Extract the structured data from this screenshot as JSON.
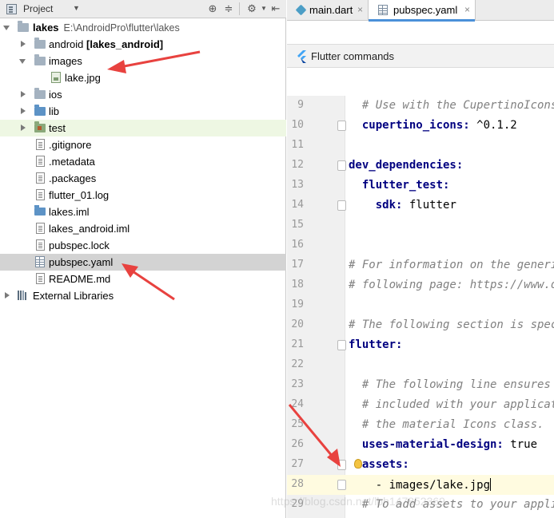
{
  "project_pane": {
    "title": "Project",
    "tree": [
      {
        "label": "lakes",
        "path": "E:\\AndroidPro\\flutter\\lakes",
        "icon": "folder-icon",
        "expanded": true
      },
      {
        "label": "android",
        "suffix": "[lakes_android]",
        "icon": "folder-icon",
        "expanded": false
      },
      {
        "label": "images",
        "icon": "folder-icon",
        "expanded": true
      },
      {
        "label": "lake.jpg",
        "icon": "image-file-icon"
      },
      {
        "label": "ios",
        "icon": "folder-icon",
        "expanded": false
      },
      {
        "label": "lib",
        "icon": "folder-icon",
        "expanded": false
      },
      {
        "label": "test",
        "icon": "test-folder-icon",
        "expanded": false
      },
      {
        "label": ".gitignore",
        "icon": "text-file-icon"
      },
      {
        "label": ".metadata",
        "icon": "text-file-icon"
      },
      {
        "label": ".packages",
        "icon": "text-file-icon"
      },
      {
        "label": "flutter_01.log",
        "icon": "text-file-icon"
      },
      {
        "label": "lakes.iml",
        "icon": "module-file-icon"
      },
      {
        "label": "lakes_android.iml",
        "icon": "text-file-icon"
      },
      {
        "label": "pubspec.lock",
        "icon": "text-file-icon"
      },
      {
        "label": "pubspec.yaml",
        "icon": "yaml-file-icon",
        "selected": true
      },
      {
        "label": "README.md",
        "icon": "text-file-icon"
      },
      {
        "label": "External Libraries",
        "icon": "library-icon",
        "expanded": false
      }
    ]
  },
  "editor": {
    "tabs": [
      {
        "label": "main.dart",
        "icon": "dart-file-icon",
        "active": false
      },
      {
        "label": "pubspec.yaml",
        "icon": "yaml-file-icon",
        "active": true
      }
    ],
    "command_bar": {
      "label": "Flutter commands",
      "icon": "flutter-icon"
    },
    "lines": [
      {
        "n": "9",
        "text": "  # Use with the CupertinoIcons "
      },
      {
        "n": "10",
        "key": "  cupertino_icons:",
        "val": " ^0.1.2"
      },
      {
        "n": "11",
        "text": ""
      },
      {
        "n": "12",
        "key": "dev_dependencies:",
        "val": ""
      },
      {
        "n": "13",
        "key": "  flutter_test:",
        "val": ""
      },
      {
        "n": "14",
        "key": "    sdk:",
        "val": " flutter"
      },
      {
        "n": "15",
        "text": ""
      },
      {
        "n": "16",
        "text": ""
      },
      {
        "n": "17",
        "text": "# For information on the generic"
      },
      {
        "n": "18",
        "text": "# following page: https://www.da"
      },
      {
        "n": "19",
        "text": ""
      },
      {
        "n": "20",
        "text": "# The following section is speci"
      },
      {
        "n": "21",
        "key": "flutter:",
        "val": ""
      },
      {
        "n": "22",
        "text": ""
      },
      {
        "n": "23",
        "text": "  # The following line ensures t"
      },
      {
        "n": "24",
        "text": "  # included with your applicatio"
      },
      {
        "n": "25",
        "text": "  # the material Icons class."
      },
      {
        "n": "26",
        "key": "  uses-material-design:",
        "val": " true"
      },
      {
        "n": "27",
        "key": "  assets:",
        "val": ""
      },
      {
        "n": "28",
        "val": "    - images/lake.jpg"
      },
      {
        "n": "29",
        "text": "  # To add assets to your applica"
      }
    ]
  },
  "watermark": "https://blog.csdn.net/lbh147852369",
  "colors": {
    "selection": "#d3d3d3",
    "highlight": "#eef7e3",
    "annotation": "#e8423f",
    "yaml_key": "#000080",
    "comment": "#808080"
  }
}
